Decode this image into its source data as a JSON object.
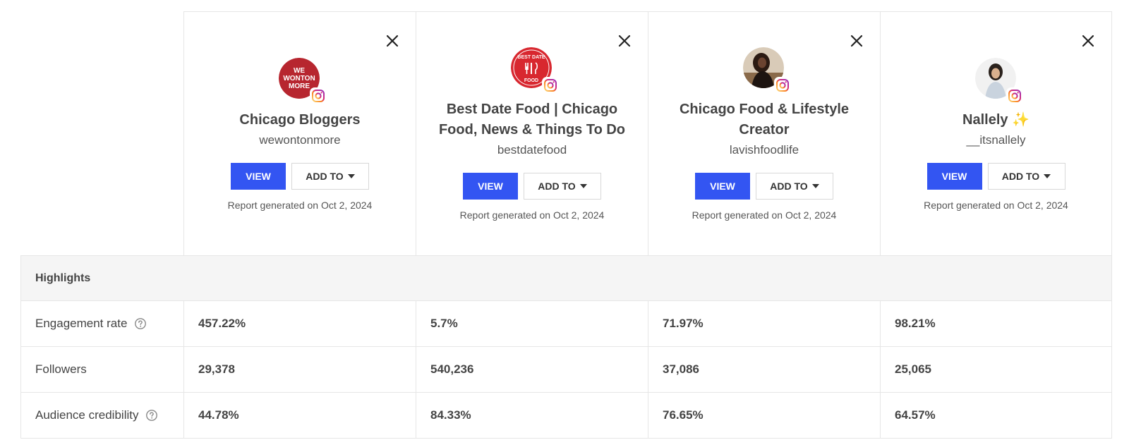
{
  "profiles": [
    {
      "name": "Chicago Bloggers",
      "handle": "wewontonmore",
      "avatar_text": [
        "WE",
        "WONTON",
        "MORE"
      ],
      "avatar_color": "#b7262f",
      "view_label": "VIEW",
      "add_to_label": "ADD TO",
      "report": "Report generated on Oct 2, 2024"
    },
    {
      "name": "Best Date Food | Chicago Food, News & Things To Do",
      "handle": "bestdatefood",
      "avatar_text": [
        "BEST DATE",
        "FOOD"
      ],
      "avatar_color": "#d8272f",
      "view_label": "VIEW",
      "add_to_label": "ADD TO",
      "report": "Report generated on Oct 2, 2024"
    },
    {
      "name": "Chicago Food & Lifestyle Creator",
      "handle": "lavishfoodlife",
      "view_label": "VIEW",
      "add_to_label": "ADD TO",
      "report": "Report generated on Oct 2, 2024"
    },
    {
      "name": "Nallely",
      "name_suffix": "✨",
      "handle": "__itsnallely",
      "view_label": "VIEW",
      "add_to_label": "ADD TO",
      "report": "Report generated on Oct 2, 2024"
    }
  ],
  "table": {
    "section_title": "Highlights",
    "rows": [
      {
        "label": "Engagement rate",
        "has_help": true,
        "values": [
          "457.22%",
          "5.7%",
          "71.97%",
          "98.21%"
        ]
      },
      {
        "label": "Followers",
        "has_help": false,
        "values": [
          "29,378",
          "540,236",
          "37,086",
          "25,065"
        ]
      },
      {
        "label": "Audience credibility",
        "has_help": true,
        "values": [
          "44.78%",
          "84.33%",
          "76.65%",
          "64.57%"
        ]
      }
    ]
  },
  "colors": {
    "primary_button": "#3355f2",
    "section_background": "#f5f5f5",
    "border": "#e6e6e6",
    "instagram_gradient": [
      "#feda75",
      "#fa7e1e",
      "#d62976",
      "#962fbf",
      "#4f5bd5"
    ]
  },
  "icons": {
    "close": "close-icon",
    "platform": "instagram-icon",
    "help": "help-circle-icon",
    "dropdown": "caret-down-icon"
  }
}
